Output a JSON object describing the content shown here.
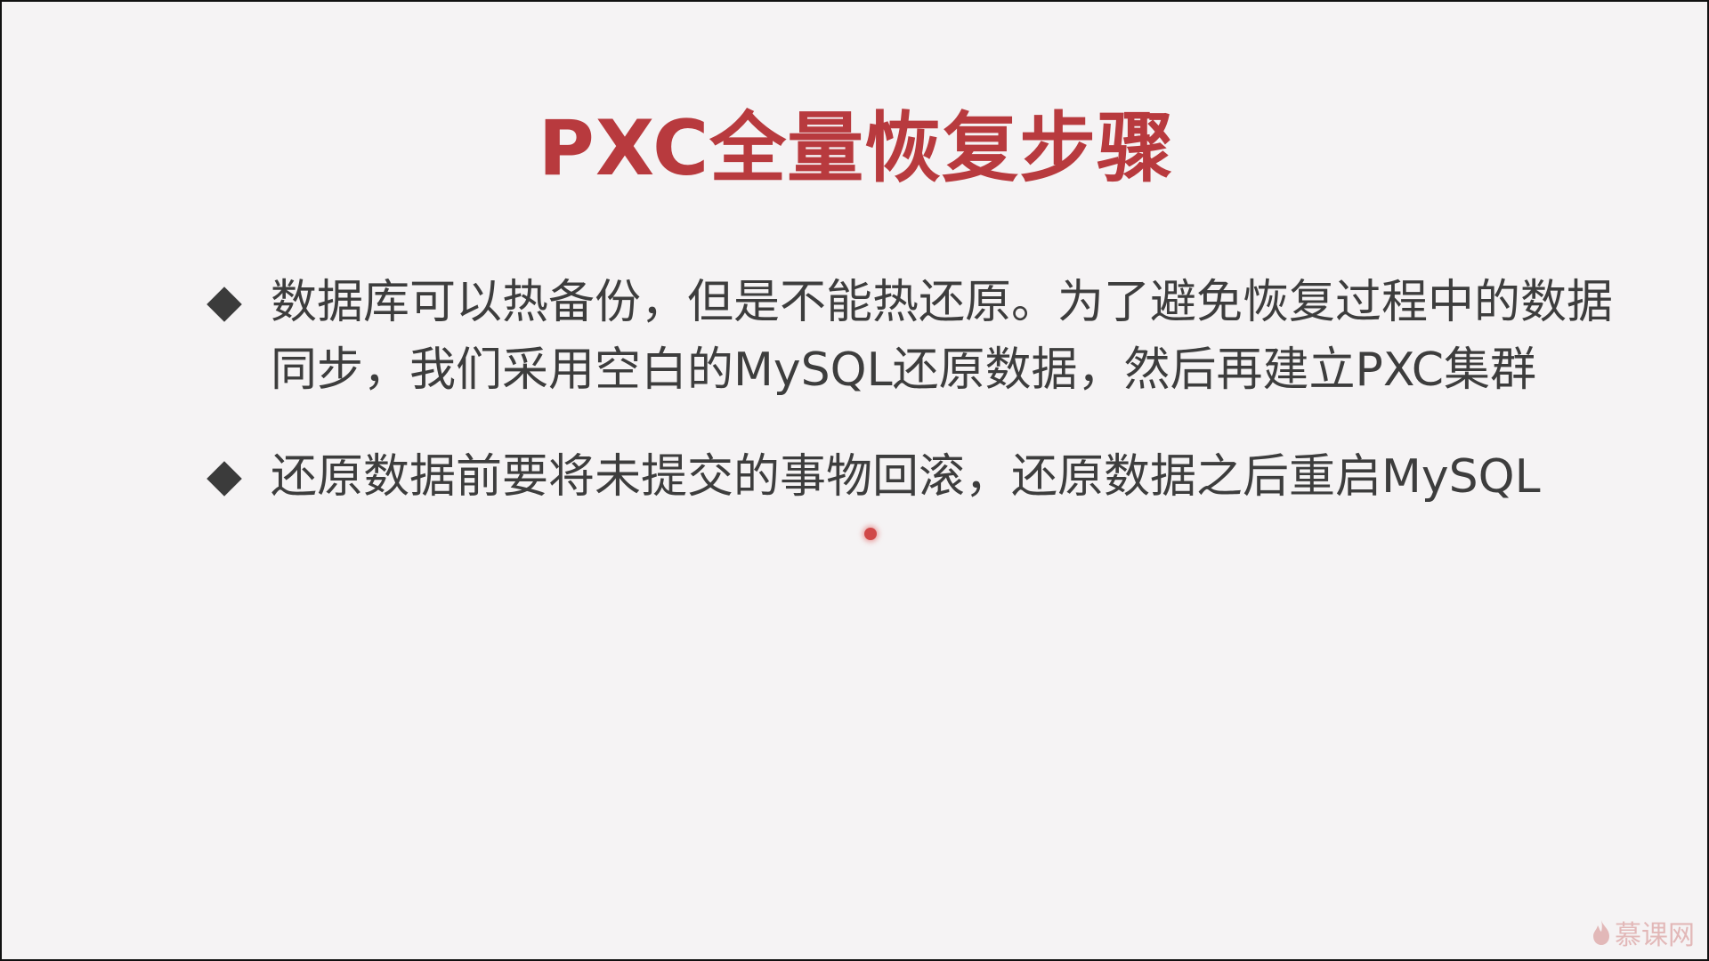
{
  "slide": {
    "title": "PXC全量恢复步骤",
    "bullets": [
      "数据库可以热备份，但是不能热还原。为了避免恢复过程中的数据同步，我们采用空白的MySQL还原数据，然后再建立PXC集群",
      "还原数据前要将未提交的事物回滚，还原数据之后重启MySQL"
    ],
    "watermark": "慕课网",
    "colors": {
      "title": "#b83a3e",
      "text": "#3d3d3d",
      "background": "#f5f3f4"
    }
  }
}
